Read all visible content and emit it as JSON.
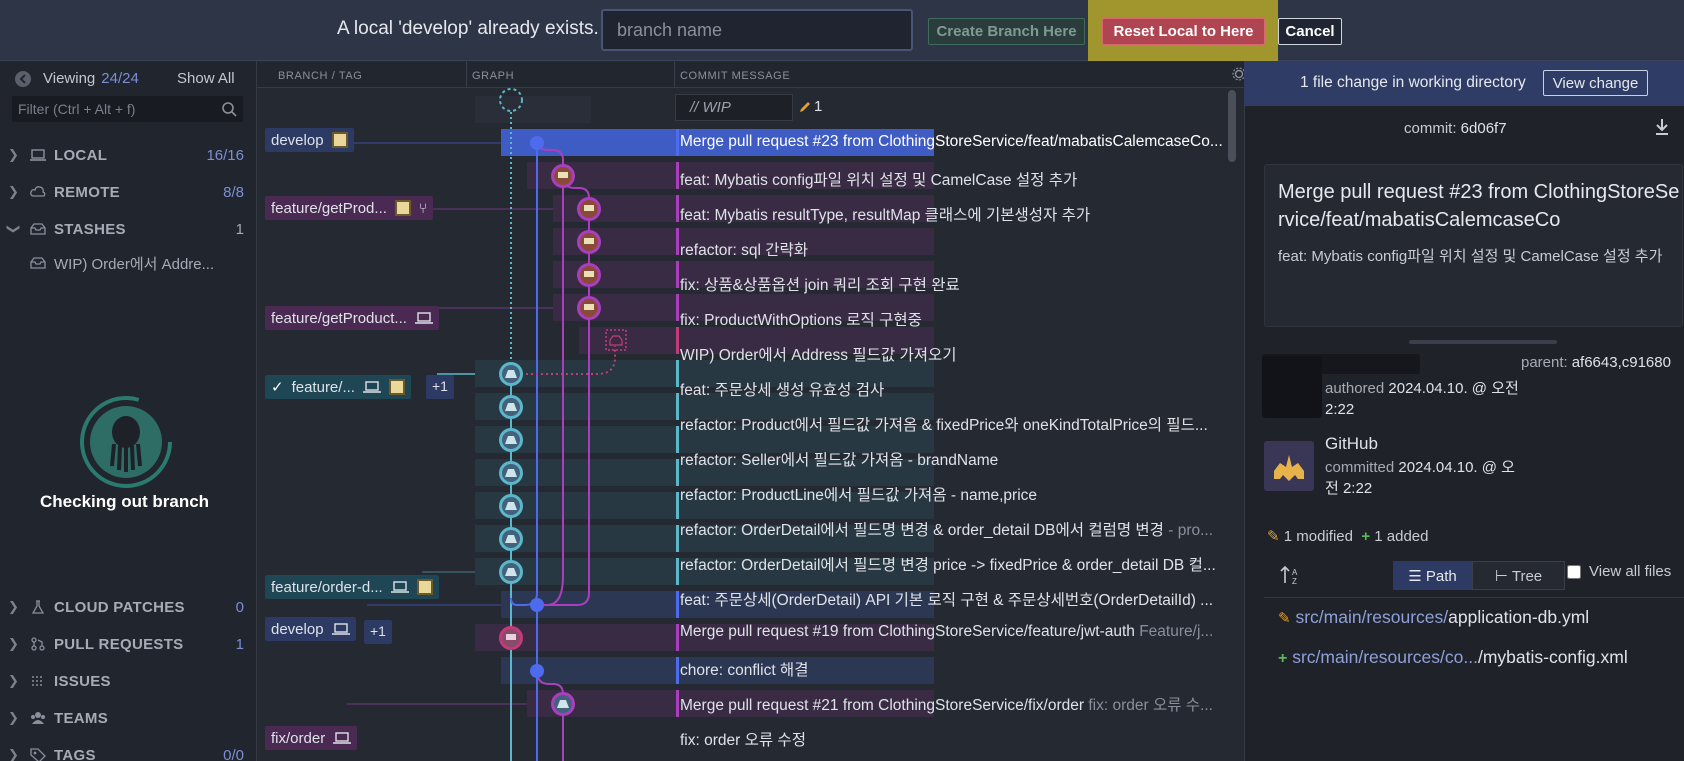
{
  "topbar": {
    "message": "A local 'develop' already exists.",
    "input_placeholder": "branch name",
    "create_label": "Create Branch Here",
    "reset_label": "Reset Local to Here",
    "cancel_label": "Cancel"
  },
  "sidebar": {
    "viewing_label": "Viewing",
    "viewing_count": "24/24",
    "show_all": "Show All",
    "filter_placeholder": "Filter (Ctrl + Alt + f)",
    "sections": [
      {
        "label": "LOCAL",
        "count": "16/16"
      },
      {
        "label": "REMOTE",
        "count": "8/8"
      },
      {
        "label": "STASHES",
        "count": "1"
      },
      {
        "label": "CLOUD PATCHES",
        "count": "0"
      },
      {
        "label": "PULL REQUESTS",
        "count": "1"
      },
      {
        "label": "ISSUES",
        "count": ""
      },
      {
        "label": "TEAMS",
        "count": ""
      },
      {
        "label": "TAGS",
        "count": "0/0"
      }
    ],
    "stash_item": "WIP) Order에서 Addre...",
    "loading_text": "Checking out branch"
  },
  "columns": {
    "branch": "BRANCH / TAG",
    "graph": "GRAPH",
    "message": "COMMIT MESSAGE"
  },
  "wip": {
    "label": "// WIP",
    "count": "1"
  },
  "tags": {
    "develop1": "develop",
    "getprod1": "feature/getProd...",
    "getprod2": "feature/getProduct...",
    "feature3": "feature/...",
    "feature3_extra": "+1",
    "orderd": "feature/order-d...",
    "develop2": "develop",
    "develop2_extra": "+1",
    "fixorder": "fix/order"
  },
  "commits": [
    {
      "msg": "Merge pull request #23 from ClothingStoreService/feat/mabatisCalemcaseCo...",
      "dim": ""
    },
    {
      "msg": "feat: Mybatis config파일 위치 설정 및 CamelCase 설정 추가",
      "dim": ""
    },
    {
      "msg": "feat: Mybatis resultType, resultMap 클래스에 기본생성자 추가",
      "dim": ""
    },
    {
      "msg": "refactor: sql 간략화",
      "dim": ""
    },
    {
      "msg": "fix: 상품&상품옵션 join 쿼리 조회 구현 완료",
      "dim": ""
    },
    {
      "msg": "fix: ProductWithOptions 로직 구현중",
      "dim": ""
    },
    {
      "msg": "WIP) Order에서 Address 필드값 가져오기",
      "dim": ""
    },
    {
      "msg": "feat: 주문상세 생성 유효성 검사",
      "dim": ""
    },
    {
      "msg": "refactor: Product에서 필드값 가져옴 & fixedPrice와 oneKindTotalPrice의 필드...",
      "dim": ""
    },
    {
      "msg": "refactor: Seller에서 필드값 가져옴 - brandName",
      "dim": ""
    },
    {
      "msg": "refactor: ProductLine에서 필드값 가져옴 - name,price",
      "dim": ""
    },
    {
      "msg": "refactor: OrderDetail에서 필드명 변경 & order_detail DB에서 컬럼명 변경",
      "dim": "- pro..."
    },
    {
      "msg": "refactor: OrderDetail에서 필드명 변경 price -> fixedPrice & order_detail DB 컬...",
      "dim": ""
    },
    {
      "msg": "feat: 주문상세(OrderDetail) API 기본 로직 구현 & 주문상세번호(OrderDetailId) ...",
      "dim": ""
    },
    {
      "msg": "Merge pull request #19 from ClothingStoreService/feature/jwt-auth",
      "dim": "Feature/j..."
    },
    {
      "msg": "chore: conflict 해결",
      "dim": ""
    },
    {
      "msg": "Merge pull request #21 from ClothingStoreService/fix/order",
      "dim": "fix: order 오류 수..."
    },
    {
      "msg": "fix: order 오류 수정",
      "dim": ""
    }
  ],
  "rightpanel": {
    "wd_text": "1 file change in working directory",
    "view_change": "View change",
    "commit_label": "commit:",
    "commit_sha": "6d06f7",
    "title": "Merge pull request #23 from ClothingStoreService/feat/mabatisCalemcaseCo",
    "body": "feat: Mybatis config파일 위치 설정 및 CamelCase 설정 추가",
    "parent_label": "parent:",
    "parent_value": "af6643,c91680",
    "authored_label": "authored",
    "authored_date": "2024.04.10. @ 오전 2:22",
    "committer": "GitHub",
    "committed_label": "committed",
    "committed_date": "2024.04.10. @ 오전 2:22",
    "modified": "1 modified",
    "added": "1 added",
    "path_btn": "Path",
    "tree_btn": "Tree",
    "view_all": "View all files",
    "files": [
      {
        "dir": "src/main/resources/",
        "name": "application-db.yml",
        "status": "modified"
      },
      {
        "dir": "src/main/resources/co...",
        "name": "/mybatis-config.xml",
        "status": "added"
      }
    ]
  },
  "colors": {
    "accent": "#4f6bed",
    "purple": "#a93fbf",
    "teal": "#5bb7c9",
    "reset": "#b04552"
  }
}
